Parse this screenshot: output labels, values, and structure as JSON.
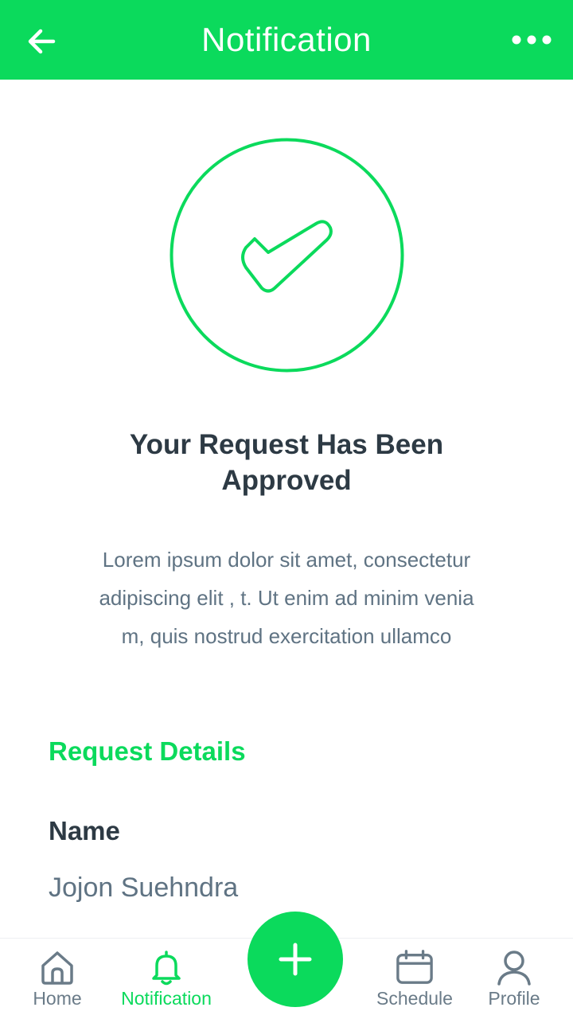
{
  "header": {
    "title": "Notification",
    "back_icon": "arrow-left-icon",
    "more_icon": "more-horizontal-icon"
  },
  "status": {
    "icon": "check-circle-icon",
    "heading_line1": "Your Request Has Been",
    "heading_line2": "Approved",
    "description_line1": "Lorem ipsum dolor sit amet, consectetur",
    "description_line2": "adipiscing elit , t. Ut enim ad minim venia",
    "description_line3": "m, quis nostrud exercitation ullamco"
  },
  "details": {
    "section_title": "Request Details",
    "name_label": "Name",
    "name_value": "Jojon Suehndra"
  },
  "bottom_nav": {
    "items": [
      {
        "label": "Home",
        "icon": "home-icon",
        "active": false
      },
      {
        "label": "Notification",
        "icon": "bell-icon",
        "active": true
      },
      {
        "label": "Schedule",
        "icon": "calendar-icon",
        "active": false
      },
      {
        "label": "Profile",
        "icon": "user-icon",
        "active": false
      }
    ],
    "fab_icon": "plus-icon"
  },
  "colors": {
    "accent": "#0bda5c",
    "text_dark": "#2d3a44",
    "text_muted": "#5f7383",
    "icon_inactive": "#6a7b88"
  }
}
